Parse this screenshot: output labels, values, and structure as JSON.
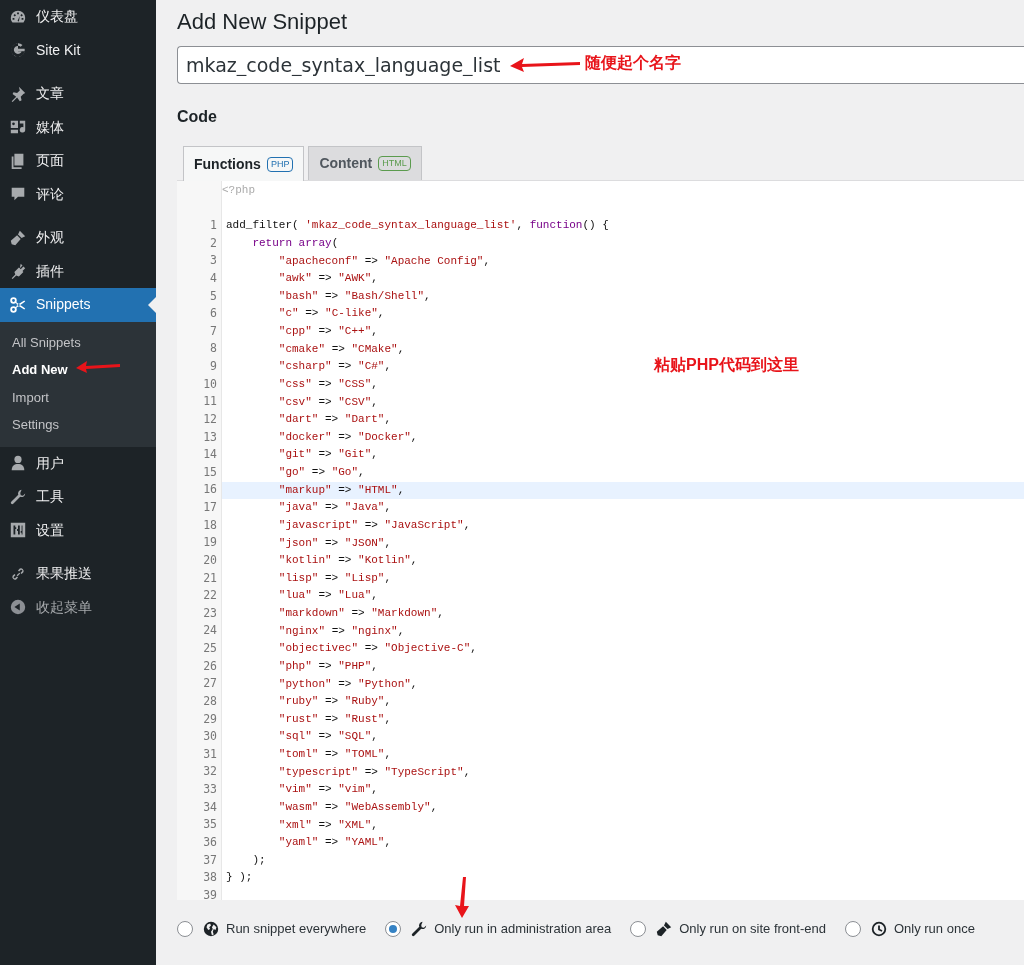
{
  "sidebar": {
    "groups": [
      [
        {
          "kind": "menu",
          "label": "仪表盘",
          "selected": false
        },
        {
          "kind": "menu",
          "label": "Site Kit",
          "selected": false
        }
      ],
      [
        {
          "kind": "menu",
          "label": "文章",
          "selected": false
        },
        {
          "kind": "menu",
          "label": "媒体",
          "selected": false
        },
        {
          "kind": "menu",
          "label": "页面",
          "selected": false
        },
        {
          "kind": "menu",
          "label": "评论",
          "selected": false
        }
      ],
      [
        {
          "kind": "menu",
          "label": "外观",
          "selected": false
        },
        {
          "kind": "menu",
          "label": "插件",
          "selected": false
        },
        {
          "kind": "menu",
          "label": "Snippets",
          "selected": true,
          "children": [
            {
              "label": "All Snippets",
              "selected": false
            },
            {
              "label": "Add New",
              "selected": true
            },
            {
              "label": "Import",
              "selected": false
            },
            {
              "label": "Settings",
              "selected": false
            }
          ]
        },
        {
          "kind": "menu",
          "label": "用户",
          "selected": false
        },
        {
          "kind": "menu",
          "label": "工具",
          "selected": false
        },
        {
          "kind": "menu",
          "label": "设置",
          "selected": false
        }
      ],
      [
        {
          "kind": "menu",
          "label": "果果推送",
          "selected": false
        },
        {
          "kind": "collapse",
          "label": "收起菜单",
          "selected": false
        }
      ]
    ]
  },
  "page_title": "Add New Snippet",
  "name_field": {
    "value": "mkaz_code_syntax_language_list"
  },
  "code_heading": "Code",
  "tabs": [
    {
      "label": "Functions",
      "badge": "PHP",
      "color": "#2271b1",
      "selected": true
    },
    {
      "label": "Content",
      "badge": "HTML",
      "color": "#5b9b4e",
      "selected": false
    }
  ],
  "editor": {
    "header": "<?php",
    "lines": [
      {
        "number": "1",
        "highlighted": false,
        "tokens": [
          {
            "kind": "plain",
            "text": "add_filter( "
          },
          {
            "kind": "string",
            "text": "'mkaz_code_syntax_language_list'"
          },
          {
            "kind": "plain",
            "text": ", "
          },
          {
            "kind": "keyword",
            "text": "function"
          },
          {
            "kind": "plain",
            "text": "() {"
          }
        ]
      },
      {
        "number": "2",
        "highlighted": false,
        "tokens": [
          {
            "kind": "keyword",
            "text": "    return array"
          },
          {
            "kind": "plain",
            "text": "("
          }
        ]
      },
      {
        "number": "3",
        "highlighted": false,
        "tokens": [
          {
            "kind": "string",
            "text": "        \"apacheconf\""
          },
          {
            "kind": "plain",
            "text": " => "
          },
          {
            "kind": "string",
            "text": "\"Apache Config\""
          },
          {
            "kind": "plain",
            "text": ","
          }
        ]
      },
      {
        "number": "4",
        "highlighted": false,
        "tokens": [
          {
            "kind": "string",
            "text": "        \"awk\""
          },
          {
            "kind": "plain",
            "text": " => "
          },
          {
            "kind": "string",
            "text": "\"AWK\""
          },
          {
            "kind": "plain",
            "text": ","
          }
        ]
      },
      {
        "number": "5",
        "highlighted": false,
        "tokens": [
          {
            "kind": "string",
            "text": "        \"bash\""
          },
          {
            "kind": "plain",
            "text": " => "
          },
          {
            "kind": "string",
            "text": "\"Bash/Shell\""
          },
          {
            "kind": "plain",
            "text": ","
          }
        ]
      },
      {
        "number": "6",
        "highlighted": false,
        "tokens": [
          {
            "kind": "string",
            "text": "        \"c\""
          },
          {
            "kind": "plain",
            "text": " => "
          },
          {
            "kind": "string",
            "text": "\"C-like\""
          },
          {
            "kind": "plain",
            "text": ","
          }
        ]
      },
      {
        "number": "7",
        "highlighted": false,
        "tokens": [
          {
            "kind": "string",
            "text": "        \"cpp\""
          },
          {
            "kind": "plain",
            "text": " => "
          },
          {
            "kind": "string",
            "text": "\"C++\""
          },
          {
            "kind": "plain",
            "text": ","
          }
        ]
      },
      {
        "number": "8",
        "highlighted": false,
        "tokens": [
          {
            "kind": "string",
            "text": "        \"cmake\""
          },
          {
            "kind": "plain",
            "text": " => "
          },
          {
            "kind": "string",
            "text": "\"CMake\""
          },
          {
            "kind": "plain",
            "text": ","
          }
        ]
      },
      {
        "number": "9",
        "highlighted": false,
        "tokens": [
          {
            "kind": "string",
            "text": "        \"csharp\""
          },
          {
            "kind": "plain",
            "text": " => "
          },
          {
            "kind": "string",
            "text": "\"C#\""
          },
          {
            "kind": "plain",
            "text": ","
          }
        ]
      },
      {
        "number": "10",
        "highlighted": false,
        "tokens": [
          {
            "kind": "string",
            "text": "        \"css\""
          },
          {
            "kind": "plain",
            "text": " => "
          },
          {
            "kind": "string",
            "text": "\"CSS\""
          },
          {
            "kind": "plain",
            "text": ","
          }
        ]
      },
      {
        "number": "11",
        "highlighted": false,
        "tokens": [
          {
            "kind": "string",
            "text": "        \"csv\""
          },
          {
            "kind": "plain",
            "text": " => "
          },
          {
            "kind": "string",
            "text": "\"CSV\""
          },
          {
            "kind": "plain",
            "text": ","
          }
        ]
      },
      {
        "number": "12",
        "highlighted": false,
        "tokens": [
          {
            "kind": "string",
            "text": "        \"dart\""
          },
          {
            "kind": "plain",
            "text": " => "
          },
          {
            "kind": "string",
            "text": "\"Dart\""
          },
          {
            "kind": "plain",
            "text": ","
          }
        ]
      },
      {
        "number": "13",
        "highlighted": false,
        "tokens": [
          {
            "kind": "string",
            "text": "        \"docker\""
          },
          {
            "kind": "plain",
            "text": " => "
          },
          {
            "kind": "string",
            "text": "\"Docker\""
          },
          {
            "kind": "plain",
            "text": ","
          }
        ]
      },
      {
        "number": "14",
        "highlighted": false,
        "tokens": [
          {
            "kind": "string",
            "text": "        \"git\""
          },
          {
            "kind": "plain",
            "text": " => "
          },
          {
            "kind": "string",
            "text": "\"Git\""
          },
          {
            "kind": "plain",
            "text": ","
          }
        ]
      },
      {
        "number": "15",
        "highlighted": false,
        "tokens": [
          {
            "kind": "string",
            "text": "        \"go\""
          },
          {
            "kind": "plain",
            "text": " => "
          },
          {
            "kind": "string",
            "text": "\"Go\""
          },
          {
            "kind": "plain",
            "text": ","
          }
        ]
      },
      {
        "number": "16",
        "highlighted": true,
        "tokens": [
          {
            "kind": "string",
            "text": "        \"markup\""
          },
          {
            "kind": "plain",
            "text": " => "
          },
          {
            "kind": "string",
            "text": "\"HTML\""
          },
          {
            "kind": "plain",
            "text": ","
          }
        ]
      },
      {
        "number": "17",
        "highlighted": false,
        "tokens": [
          {
            "kind": "string",
            "text": "        \"java\""
          },
          {
            "kind": "plain",
            "text": " => "
          },
          {
            "kind": "string",
            "text": "\"Java\""
          },
          {
            "kind": "plain",
            "text": ","
          }
        ]
      },
      {
        "number": "18",
        "highlighted": false,
        "tokens": [
          {
            "kind": "string",
            "text": "        \"javascript\""
          },
          {
            "kind": "plain",
            "text": " => "
          },
          {
            "kind": "string",
            "text": "\"JavaScript\""
          },
          {
            "kind": "plain",
            "text": ","
          }
        ]
      },
      {
        "number": "19",
        "highlighted": false,
        "tokens": [
          {
            "kind": "string",
            "text": "        \"json\""
          },
          {
            "kind": "plain",
            "text": " => "
          },
          {
            "kind": "string",
            "text": "\"JSON\""
          },
          {
            "kind": "plain",
            "text": ","
          }
        ]
      },
      {
        "number": "20",
        "highlighted": false,
        "tokens": [
          {
            "kind": "string",
            "text": "        \"kotlin\""
          },
          {
            "kind": "plain",
            "text": " => "
          },
          {
            "kind": "string",
            "text": "\"Kotlin\""
          },
          {
            "kind": "plain",
            "text": ","
          }
        ]
      },
      {
        "number": "21",
        "highlighted": false,
        "tokens": [
          {
            "kind": "string",
            "text": "        \"lisp\""
          },
          {
            "kind": "plain",
            "text": " => "
          },
          {
            "kind": "string",
            "text": "\"Lisp\""
          },
          {
            "kind": "plain",
            "text": ","
          }
        ]
      },
      {
        "number": "22",
        "highlighted": false,
        "tokens": [
          {
            "kind": "string",
            "text": "        \"lua\""
          },
          {
            "kind": "plain",
            "text": " => "
          },
          {
            "kind": "string",
            "text": "\"Lua\""
          },
          {
            "kind": "plain",
            "text": ","
          }
        ]
      },
      {
        "number": "23",
        "highlighted": false,
        "tokens": [
          {
            "kind": "string",
            "text": "        \"markdown\""
          },
          {
            "kind": "plain",
            "text": " => "
          },
          {
            "kind": "string",
            "text": "\"Markdown\""
          },
          {
            "kind": "plain",
            "text": ","
          }
        ]
      },
      {
        "number": "24",
        "highlighted": false,
        "tokens": [
          {
            "kind": "string",
            "text": "        \"nginx\""
          },
          {
            "kind": "plain",
            "text": " => "
          },
          {
            "kind": "string",
            "text": "\"nginx\""
          },
          {
            "kind": "plain",
            "text": ","
          }
        ]
      },
      {
        "number": "25",
        "highlighted": false,
        "tokens": [
          {
            "kind": "string",
            "text": "        \"objectivec\""
          },
          {
            "kind": "plain",
            "text": " => "
          },
          {
            "kind": "string",
            "text": "\"Objective-C\""
          },
          {
            "kind": "plain",
            "text": ","
          }
        ]
      },
      {
        "number": "26",
        "highlighted": false,
        "tokens": [
          {
            "kind": "string",
            "text": "        \"php\""
          },
          {
            "kind": "plain",
            "text": " => "
          },
          {
            "kind": "string",
            "text": "\"PHP\""
          },
          {
            "kind": "plain",
            "text": ","
          }
        ]
      },
      {
        "number": "27",
        "highlighted": false,
        "tokens": [
          {
            "kind": "string",
            "text": "        \"python\""
          },
          {
            "kind": "plain",
            "text": " => "
          },
          {
            "kind": "string",
            "text": "\"Python\""
          },
          {
            "kind": "plain",
            "text": ","
          }
        ]
      },
      {
        "number": "28",
        "highlighted": false,
        "tokens": [
          {
            "kind": "string",
            "text": "        \"ruby\""
          },
          {
            "kind": "plain",
            "text": " => "
          },
          {
            "kind": "string",
            "text": "\"Ruby\""
          },
          {
            "kind": "plain",
            "text": ","
          }
        ]
      },
      {
        "number": "29",
        "highlighted": false,
        "tokens": [
          {
            "kind": "string",
            "text": "        \"rust\""
          },
          {
            "kind": "plain",
            "text": " => "
          },
          {
            "kind": "string",
            "text": "\"Rust\""
          },
          {
            "kind": "plain",
            "text": ","
          }
        ]
      },
      {
        "number": "30",
        "highlighted": false,
        "tokens": [
          {
            "kind": "string",
            "text": "        \"sql\""
          },
          {
            "kind": "plain",
            "text": " => "
          },
          {
            "kind": "string",
            "text": "\"SQL\""
          },
          {
            "kind": "plain",
            "text": ","
          }
        ]
      },
      {
        "number": "31",
        "highlighted": false,
        "tokens": [
          {
            "kind": "string",
            "text": "        \"toml\""
          },
          {
            "kind": "plain",
            "text": " => "
          },
          {
            "kind": "string",
            "text": "\"TOML\""
          },
          {
            "kind": "plain",
            "text": ","
          }
        ]
      },
      {
        "number": "32",
        "highlighted": false,
        "tokens": [
          {
            "kind": "string",
            "text": "        \"typescript\""
          },
          {
            "kind": "plain",
            "text": " => "
          },
          {
            "kind": "string",
            "text": "\"TypeScript\""
          },
          {
            "kind": "plain",
            "text": ","
          }
        ]
      },
      {
        "number": "33",
        "highlighted": false,
        "tokens": [
          {
            "kind": "string",
            "text": "        \"vim\""
          },
          {
            "kind": "plain",
            "text": " => "
          },
          {
            "kind": "string",
            "text": "\"vim\""
          },
          {
            "kind": "plain",
            "text": ","
          }
        ]
      },
      {
        "number": "34",
        "highlighted": false,
        "tokens": [
          {
            "kind": "string",
            "text": "        \"wasm\""
          },
          {
            "kind": "plain",
            "text": " => "
          },
          {
            "kind": "string",
            "text": "\"WebAssembly\""
          },
          {
            "kind": "plain",
            "text": ","
          }
        ]
      },
      {
        "number": "35",
        "highlighted": false,
        "tokens": [
          {
            "kind": "string",
            "text": "        \"xml\""
          },
          {
            "kind": "plain",
            "text": " => "
          },
          {
            "kind": "string",
            "text": "\"XML\""
          },
          {
            "kind": "plain",
            "text": ","
          }
        ]
      },
      {
        "number": "36",
        "highlighted": false,
        "tokens": [
          {
            "kind": "string",
            "text": "        \"yaml\""
          },
          {
            "kind": "plain",
            "text": " => "
          },
          {
            "kind": "string",
            "text": "\"YAML\""
          },
          {
            "kind": "plain",
            "text": ","
          }
        ]
      },
      {
        "number": "37",
        "highlighted": false,
        "tokens": [
          {
            "kind": "plain",
            "text": "    );"
          }
        ]
      },
      {
        "number": "38",
        "highlighted": false,
        "tokens": [
          {
            "kind": "plain",
            "text": "} );"
          }
        ]
      },
      {
        "number": "39",
        "highlighted": false
      }
    ]
  },
  "scope_options": [
    {
      "label": "Run snippet everywhere",
      "selected": false
    },
    {
      "label": "Only run in administration area",
      "selected": true
    },
    {
      "label": "Only run on site front-end",
      "selected": false
    },
    {
      "label": "Only run once",
      "selected": false
    }
  ],
  "annotations": [
    "随便起个名字",
    "粘贴PHP代码到这里"
  ]
}
